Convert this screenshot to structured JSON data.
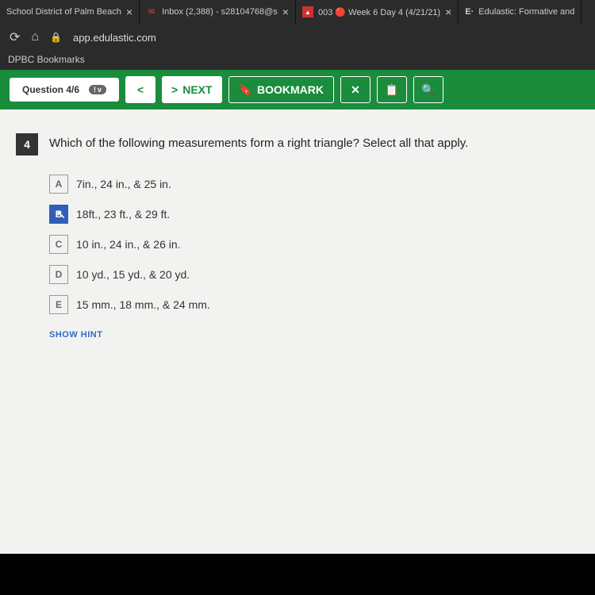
{
  "browser": {
    "tabs": [
      {
        "title": "School District of Palm Beach"
      },
      {
        "title": "Inbox (2,388) - s28104768@s"
      },
      {
        "title": "003 🔴 Week 6 Day 4 (4/21/21)"
      },
      {
        "title": "Edulastic: Formative and"
      }
    ],
    "url_host": "app.edulastic.com",
    "bookmarks_label": "DPBC Bookmarks"
  },
  "header": {
    "question_counter": "Question 4/6",
    "badge_icon": "!",
    "badge_caret": "v",
    "prev": "<",
    "next_label": "NEXT",
    "next_arrow": ">",
    "bookmark_label": "BOOKMARK",
    "close": "✕",
    "calc": "📋",
    "search": "🔍"
  },
  "question": {
    "number": "4",
    "text": "Which of the following measurements form a right triangle? Select all that apply.",
    "options": [
      {
        "letter": "A",
        "text": "7in., 24 in., & 25 in.",
        "selected": false
      },
      {
        "letter": "B",
        "text": "18ft., 23 ft., & 29 ft.",
        "selected": true
      },
      {
        "letter": "C",
        "text": "10 in., 24 in., & 26 in.",
        "selected": false
      },
      {
        "letter": "D",
        "text": "10 yd., 15 yd., & 20 yd.",
        "selected": false
      },
      {
        "letter": "E",
        "text": "15 mm., 18 mm., & 24 mm.",
        "selected": false
      }
    ],
    "hint_label": "SHOW HINT"
  }
}
